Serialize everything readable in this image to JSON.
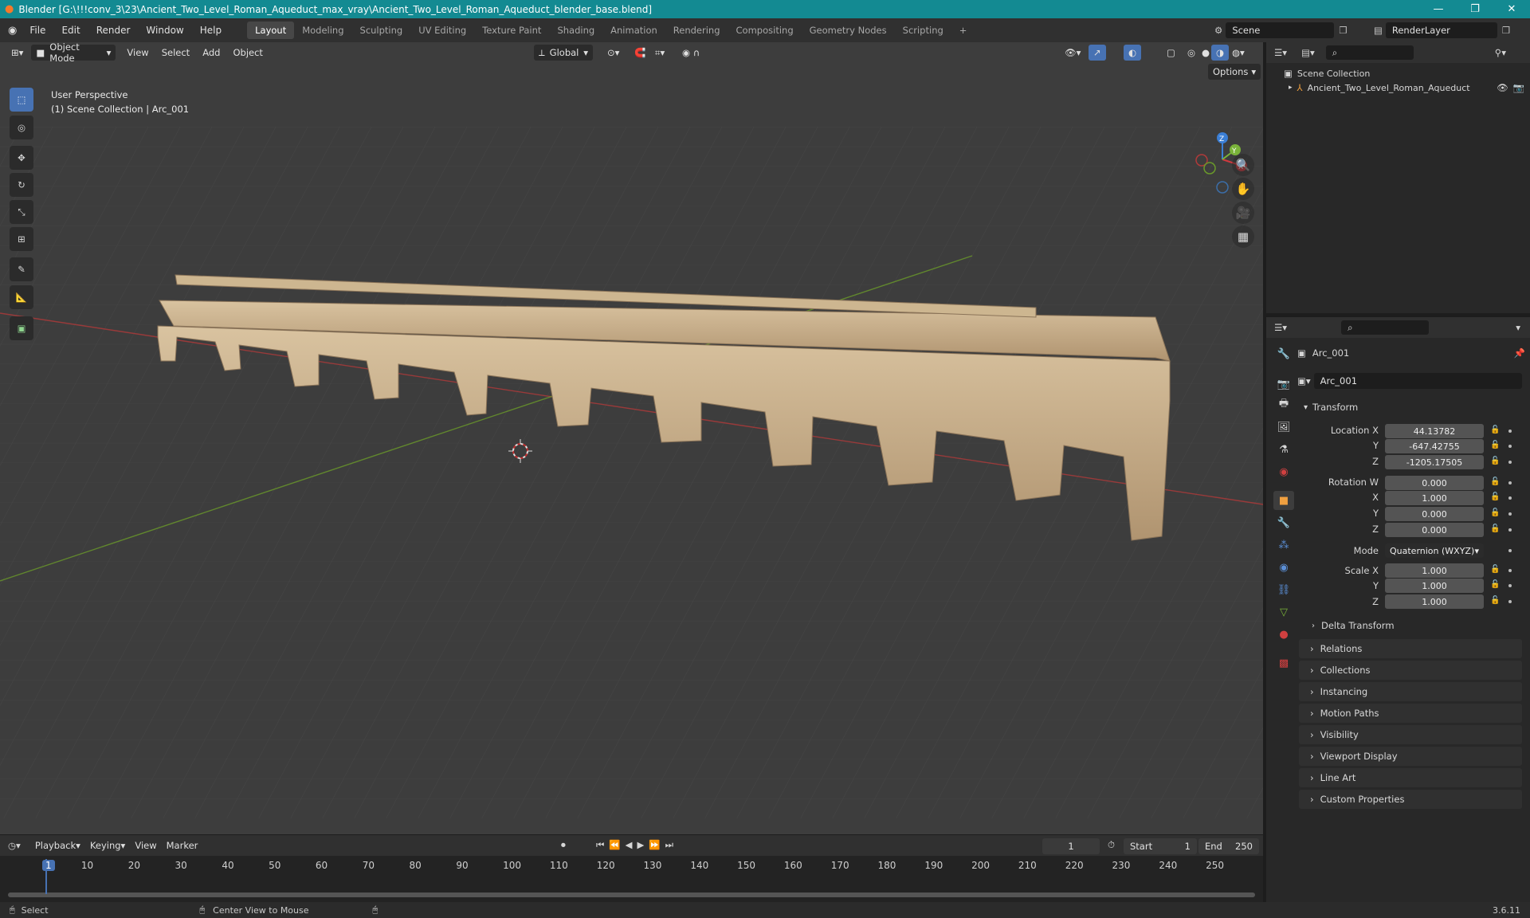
{
  "window": {
    "title": "Blender [G:\\!!!conv_3\\23\\Ancient_Two_Level_Roman_Aqueduct_max_vray\\Ancient_Two_Level_Roman_Aqueduct_blender_base.blend]",
    "controls": [
      "—",
      "❐",
      "✕"
    ]
  },
  "menu": [
    "File",
    "Edit",
    "Render",
    "Window",
    "Help"
  ],
  "workspaces": [
    {
      "label": "Layout",
      "active": true
    },
    {
      "label": "Modeling"
    },
    {
      "label": "Sculpting"
    },
    {
      "label": "UV Editing"
    },
    {
      "label": "Texture Paint"
    },
    {
      "label": "Shading"
    },
    {
      "label": "Animation"
    },
    {
      "label": "Rendering"
    },
    {
      "label": "Compositing"
    },
    {
      "label": "Geometry Nodes"
    },
    {
      "label": "Scripting"
    }
  ],
  "add_workspace": "+",
  "scene": {
    "name": "Scene",
    "render_layer": "RenderLayer"
  },
  "viewport": {
    "mode": "Object Mode",
    "menus": [
      "View",
      "Select",
      "Add",
      "Object"
    ],
    "transform_orientation": "Global",
    "options_label": "Options",
    "overlay_line1": "User Perspective",
    "overlay_line2": "(1) Scene Collection | Arc_001",
    "gizmo_axes": {
      "x": "X",
      "y": "Y",
      "z": "Z"
    },
    "colors": {
      "bg": "#3d3d3d",
      "x_axis": "#b03a3a",
      "y_axis": "#6a9a2a",
      "stone": "#c9b08a"
    }
  },
  "outliner": {
    "root": "Scene Collection",
    "items": [
      {
        "label": "Ancient_Two_Level_Roman_Aqueduct"
      }
    ]
  },
  "properties": {
    "object_name": "Arc_001",
    "datablock_name": "Arc_001",
    "transform_header": "Transform",
    "location_label": "Location X",
    "location": [
      "44.13782",
      "-647.42755",
      "-1205.17505"
    ],
    "rotation_label": "Rotation W",
    "rotation": [
      "0.000",
      "1.000",
      "0.000",
      "0.000"
    ],
    "axis_labels": [
      "X",
      "Y",
      "Z"
    ],
    "mode_label": "Mode",
    "mode_value": "Quaternion (WXYZ)",
    "scale_label": "Scale X",
    "scale": [
      "1.000",
      "1.000",
      "1.000"
    ],
    "delta_transform": "Delta Transform",
    "panels": [
      "Relations",
      "Collections",
      "Instancing",
      "Motion Paths",
      "Visibility",
      "Viewport Display",
      "Line Art",
      "Custom Properties"
    ]
  },
  "timeline": {
    "menus": [
      "Playback",
      "Keying",
      "View",
      "Marker"
    ],
    "current_frame": "1",
    "start_label": "Start",
    "start": "1",
    "end_label": "End",
    "end": "250",
    "ruler": [
      "1",
      "10",
      "20",
      "30",
      "40",
      "50",
      "60",
      "70",
      "80",
      "90",
      "100",
      "110",
      "120",
      "130",
      "140",
      "150",
      "160",
      "170",
      "180",
      "190",
      "200",
      "210",
      "220",
      "230",
      "240",
      "250"
    ]
  },
  "status": {
    "left": "Select",
    "middle": "Center View to Mouse",
    "version": "3.6.11"
  }
}
